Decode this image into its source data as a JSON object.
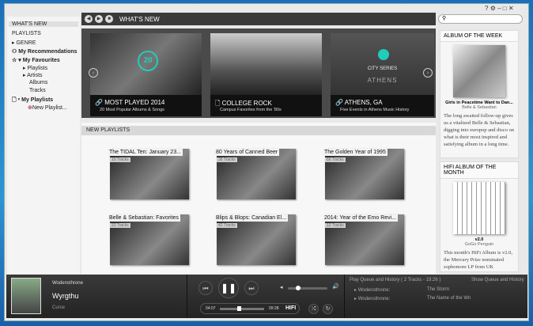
{
  "window": {
    "help": "?",
    "settings_icon": "gear-icon"
  },
  "sidebar": {
    "whats_new": "WHAT'S NEW",
    "playlists": "PLAYLISTS",
    "genre": "GENRE",
    "my_recommendations": "My Recommendations",
    "my_favourites": "My Favourites",
    "fav_playlists": "Playlists",
    "fav_artists": "Artists",
    "fav_albums": "Albums",
    "fav_tracks": "Tracks",
    "my_playlists": "My Playlists",
    "new_playlist": "New Playlist..."
  },
  "header": {
    "title": "WHAT'S NEW",
    "search_placeholder": ""
  },
  "hero": [
    {
      "title": "MOST PLAYED 2014",
      "subtitle": "20 Most Popular Albums & Songs",
      "badge": "20"
    },
    {
      "title": "COLLEGE ROCK",
      "subtitle": "Campus Favorites from the '80s"
    },
    {
      "title": "ATHENS, GA",
      "subtitle": "Five Events in Athens Music History",
      "overlay1": "CITY SERIES",
      "overlay2": "ATHENS"
    }
  ],
  "new_playlists": {
    "heading": "NEW PLAYLISTS",
    "items": [
      {
        "name": "The TIDAL Ten: January 23...",
        "count": "10 Tracks"
      },
      {
        "name": "80 Years of Canned Beer",
        "count": "36 Tracks"
      },
      {
        "name": "The Golden Year of 1995",
        "count": "66 Tracks"
      },
      {
        "name": "Belle & Sebastian: Favorites",
        "count": "22 Tracks"
      },
      {
        "name": "Blips & Blops: Canadian El...",
        "count": "42 Tracks"
      },
      {
        "name": "2014: Year of the Emo Revi...",
        "count": "12 Tracks"
      }
    ]
  },
  "album_of_week": {
    "heading": "ALBUM OF THE WEEK",
    "title": "Girls in Peacetime Want to Dan...",
    "artist": "Belle & Sebastian",
    "description": "The long awaited follow-up gives us a vitalized Belle & Sebastian, digging into europop and disco on what is their most inspired and satisfying album in a long time."
  },
  "hifi_album": {
    "heading": "HIFI ALBUM OF THE MONTH",
    "title": "v2.0",
    "artist": "GoGo Penguin",
    "description": "This month's HiFi Album is v2.0, the Mercury Prize nominated sophomore LP from UK newcomers GoGo Penguin."
  },
  "player": {
    "artist": "Wodensthrone",
    "track": "Wyrgthu",
    "album": "Curse",
    "elapsed": "04:07",
    "total": "09:28",
    "progress": 0.42,
    "volume": 0.25,
    "quality": "HIFI"
  },
  "queue": {
    "title": "Play Queue and History ( 2 Tracks - 19:26 )",
    "show": "Show Queue and History",
    "items": [
      {
        "artist": "Wodensthrone:",
        "track": "The Storm"
      },
      {
        "artist": "Wodensthrone:",
        "track": "The Name of the Wn"
      }
    ]
  }
}
